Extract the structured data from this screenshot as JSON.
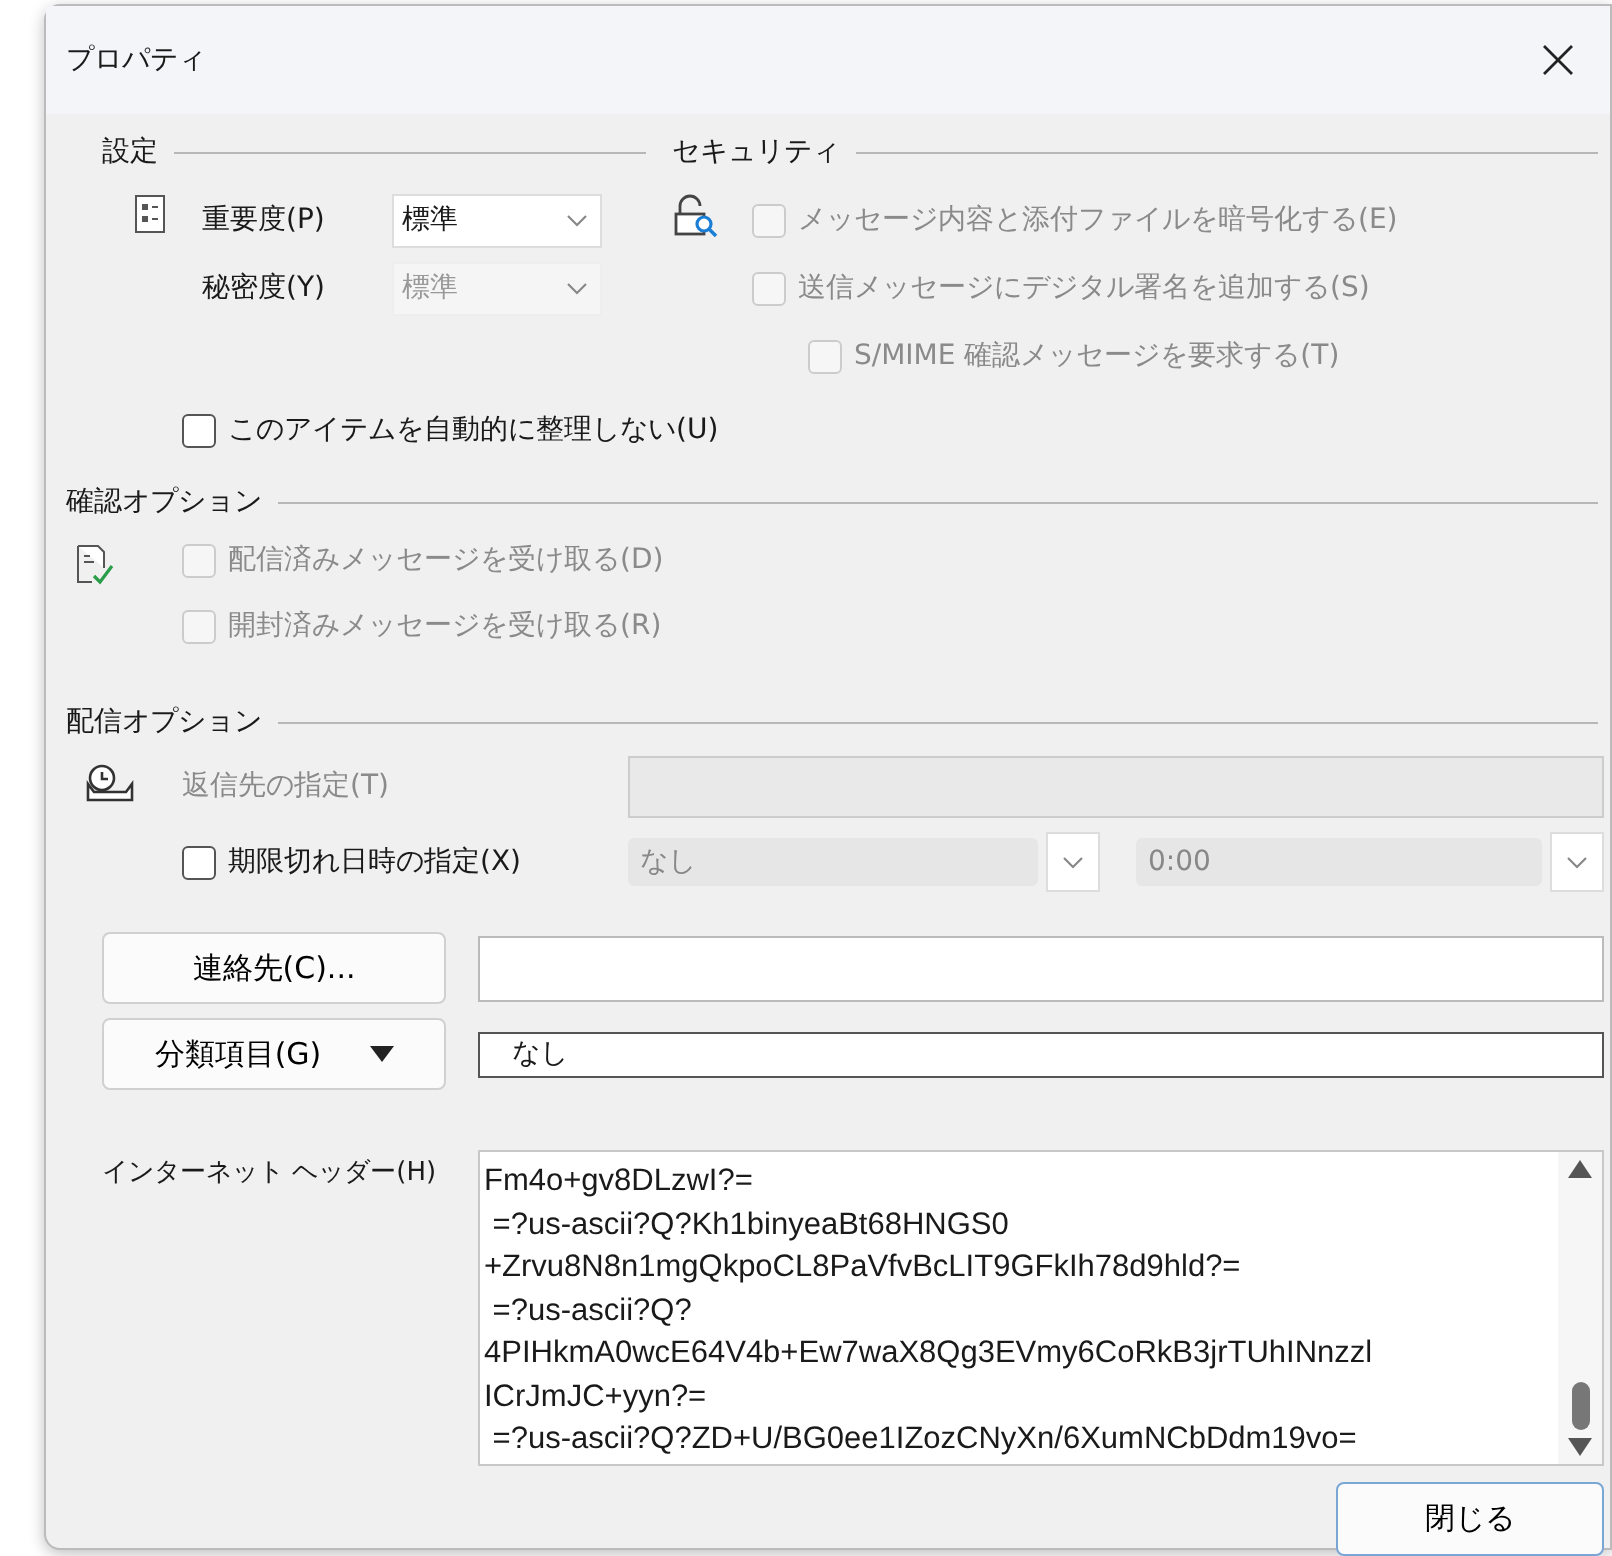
{
  "window": {
    "title": "プロパティ"
  },
  "settings": {
    "heading": "設定",
    "fields": [
      {
        "label": "重要度(P)",
        "value": "標準",
        "disabled": false
      },
      {
        "label": "秘密度(Y)",
        "value": "標準",
        "disabled": true
      }
    ],
    "auto_archive": {
      "label": "このアイテムを自動的に整理しない(U)",
      "checked": false,
      "disabled": false
    }
  },
  "security": {
    "heading": "セキュリティ",
    "options": [
      {
        "label": "メッセージ内容と添付ファイルを暗号化する(E)",
        "checked": false,
        "disabled": true
      },
      {
        "label": "送信メッセージにデジタル署名を追加する(S)",
        "checked": false,
        "disabled": true,
        "children": [
          {
            "label": "S/MIME 確認メッセージを要求する(T)",
            "checked": false,
            "disabled": true
          }
        ]
      }
    ]
  },
  "tracking": {
    "heading": "確認オプション",
    "options": [
      {
        "label": "配信済みメッセージを受け取る(D)",
        "checked": false,
        "disabled": true
      },
      {
        "label": "開封済みメッセージを受け取る(R)",
        "checked": false,
        "disabled": true
      }
    ]
  },
  "delivery": {
    "heading": "配信オプション",
    "reply_to": {
      "label": "返信先の指定(T)",
      "disabled": true
    },
    "expires": {
      "label": "期限切れ日時の指定(X)",
      "checked": false,
      "disabled": false,
      "date": {
        "value": "なし",
        "disabled": true
      },
      "time": {
        "value": "0:00",
        "disabled": true
      }
    }
  },
  "contacts": {
    "button": "連絡先(C)..."
  },
  "categories": {
    "button": "分類項目(G)",
    "value": "なし"
  },
  "headers": {
    "label": "インターネット ヘッダー(H)",
    "lines": [
      "Fm4o+gv8DLzwI?=",
      " =?us-ascii?Q?Kh1binyeaBt68HNGS0",
      "+Zrvu8N8n1mgQkpoCL8PaVfvBcLIT9GFkIh78d9hld?=",
      " =?us-ascii?Q?",
      "4PIHkmA0wcE64V4b+Ew7waX8Qg3EVmy6CoRkB3jrTUhINnzzl",
      "ICrJmJC+yyn?=",
      " =?us-ascii?Q?ZD+U/BG0ee1IZozCNyXn/6XumNCbDdm19vo="
    ]
  },
  "buttons": [
    {
      "label": "閉じる"
    }
  ]
}
